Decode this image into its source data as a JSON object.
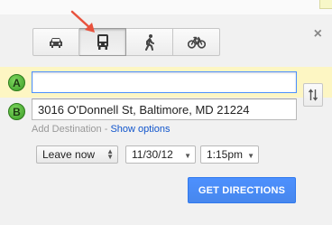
{
  "travel_modes": [
    {
      "name": "car",
      "icon": "car-icon",
      "active": false
    },
    {
      "name": "transit",
      "icon": "bus-icon",
      "active": true
    },
    {
      "name": "walking",
      "icon": "walking-icon",
      "active": false
    },
    {
      "name": "bicycling",
      "icon": "bicycle-icon",
      "active": false
    }
  ],
  "close_icon": "×",
  "waypoints": {
    "a": {
      "marker": "A",
      "value": "",
      "placeholder": ""
    },
    "b": {
      "marker": "B",
      "value": "3016 O'Donnell St, Baltimore, MD 21224"
    }
  },
  "add_destination": {
    "label": "Add Destination",
    "separator": " - ",
    "show_options": "Show options"
  },
  "time_options": {
    "mode": "Leave now",
    "date": "11/30/12",
    "time": "1:15pm"
  },
  "get_directions_label": "GET DIRECTIONS",
  "colors": {
    "accent_button": "#4d90fe",
    "marker_green": "#3a9b26",
    "highlight_row": "#fdf6c3",
    "link": "#1155cc",
    "annotation_arrow": "#e8523d"
  }
}
